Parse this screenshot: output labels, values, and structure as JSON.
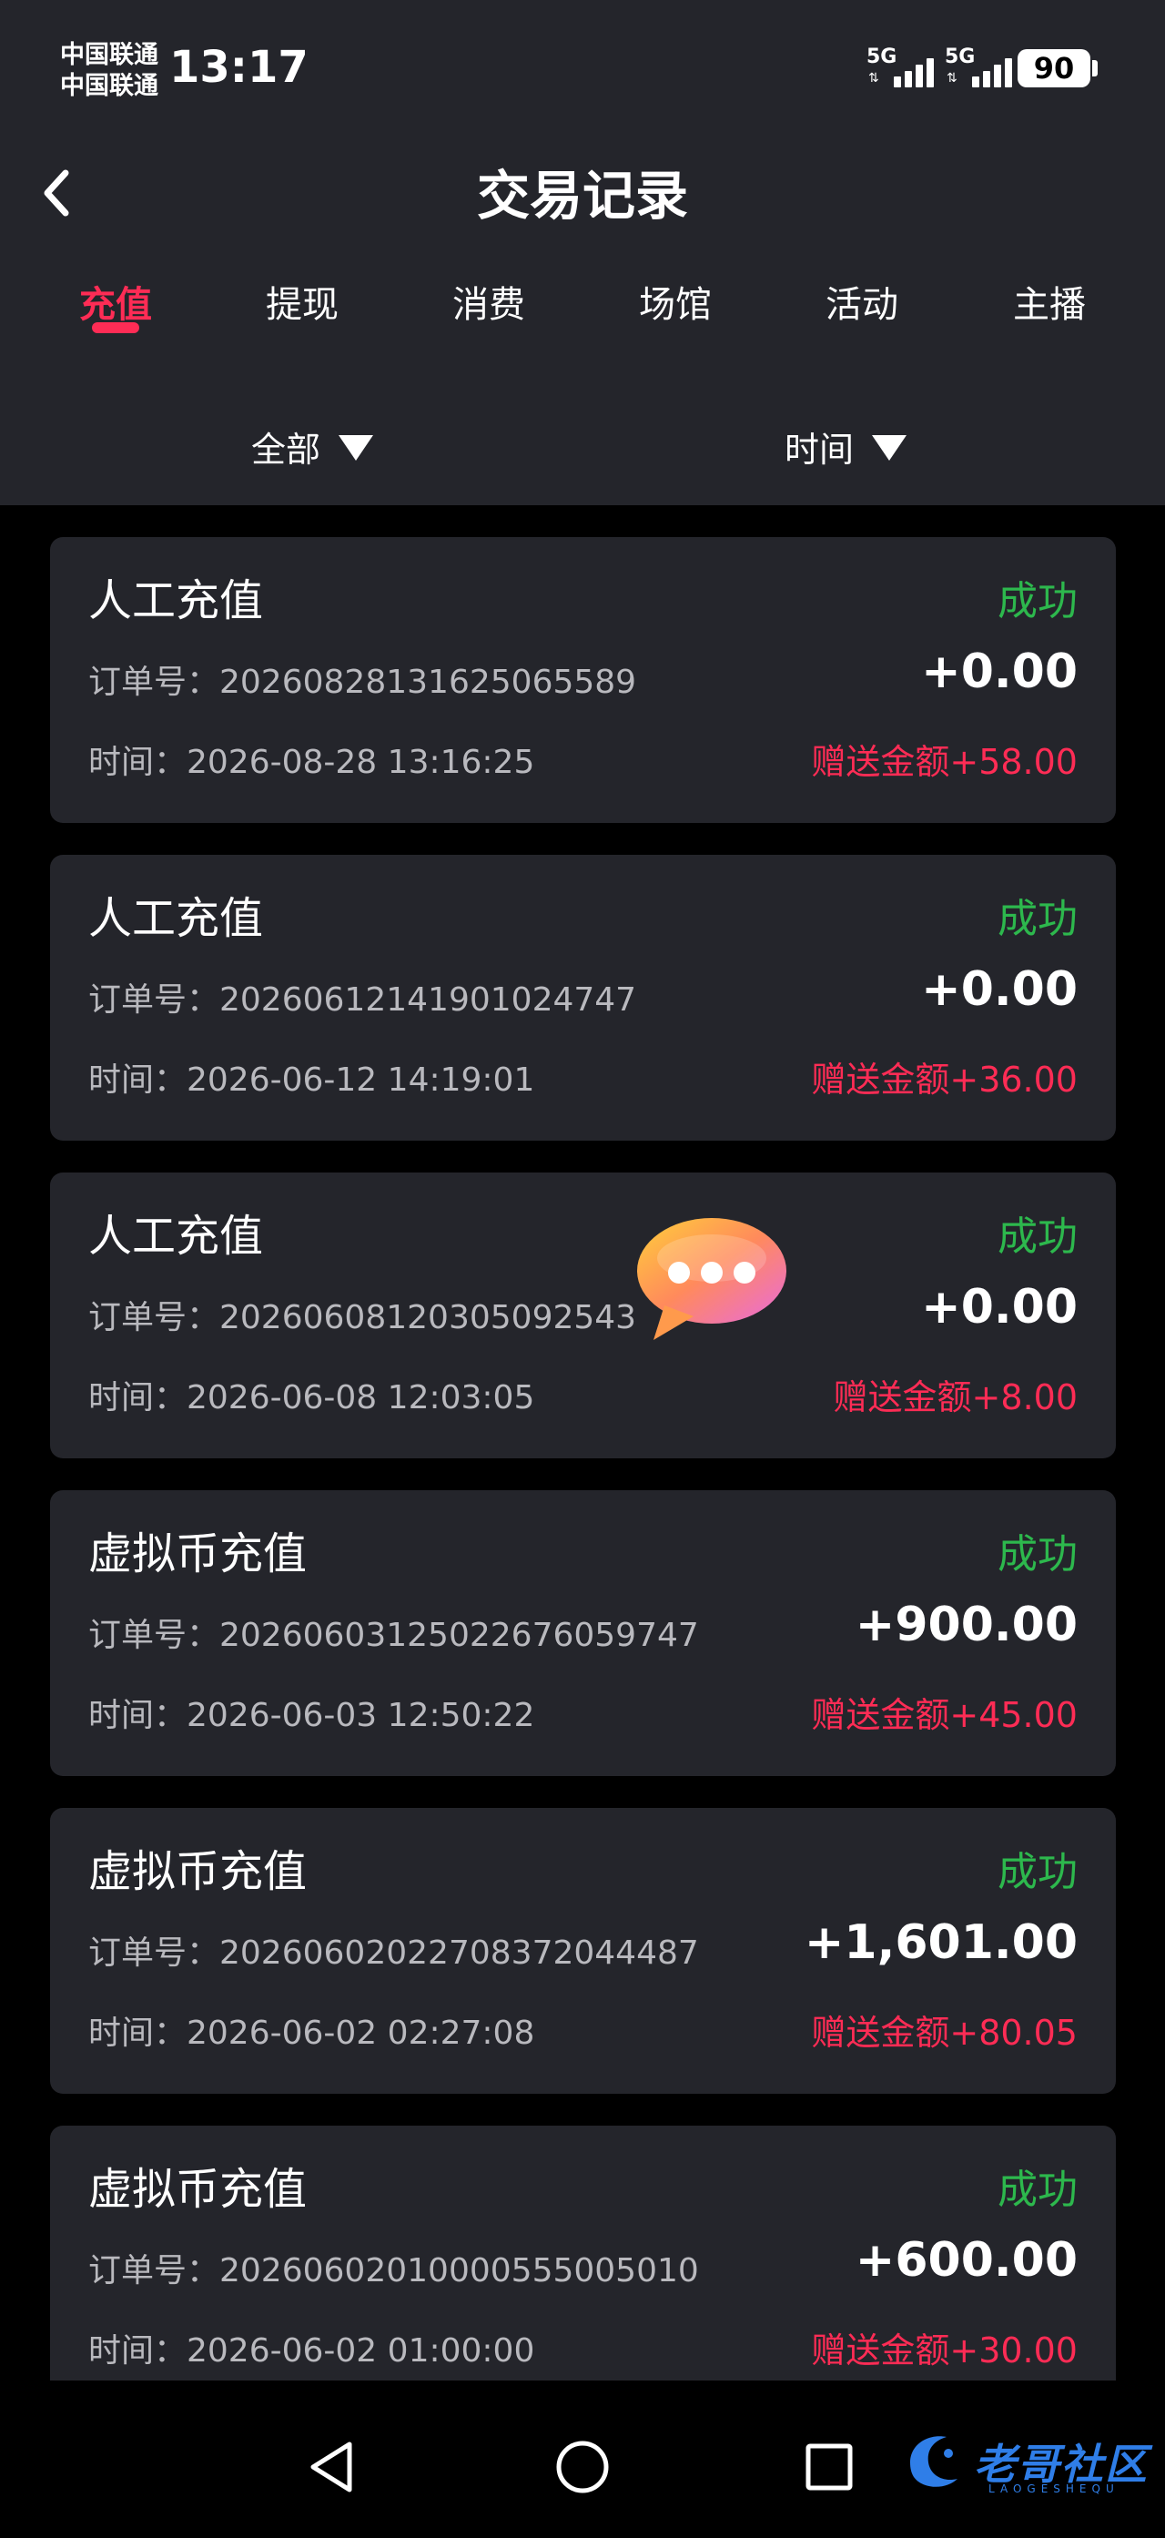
{
  "status_bar": {
    "carrier_1": "中国联通",
    "carrier_2": "中国联通",
    "time": "13:17",
    "network_1": "5G",
    "network_2": "5G",
    "battery": "90"
  },
  "header": {
    "title": "交易记录",
    "back_icon": "chevron-left-icon"
  },
  "tabs": [
    {
      "label": "充值",
      "active": true
    },
    {
      "label": "提现",
      "active": false
    },
    {
      "label": "消费",
      "active": false
    },
    {
      "label": "场馆",
      "active": false
    },
    {
      "label": "活动",
      "active": false
    },
    {
      "label": "主播",
      "active": false
    }
  ],
  "filters": {
    "category": "全部",
    "time": "时间"
  },
  "records": [
    {
      "type": "人工充值",
      "status": "成功",
      "order": "订单号：2026082813162506558​9",
      "amount": "+0.00",
      "time": "时间：2026-08-28 13:16:25",
      "bonus": "赠送金额+58.00"
    },
    {
      "type": "人工充值",
      "status": "成功",
      "order": "订单号：202606121419010247​47",
      "amount": "+0.00",
      "time": "时间：2026-06-12 14:19:01",
      "bonus": "赠送金额+36.00"
    },
    {
      "type": "人工充值",
      "status": "成功",
      "order": "订单号：2026060812030509254​3",
      "amount": "+0.00",
      "time": "时间：2026-06-08 12:03:05",
      "bonus": "赠送金额+8.00"
    },
    {
      "type": "虚拟币充值",
      "status": "成功",
      "order": "订单号：2026060312502267605​9747",
      "amount": "+900.00",
      "time": "时间：2026-06-03 12:50:22",
      "bonus": "赠送金额+45.00"
    },
    {
      "type": "虚拟币充值",
      "status": "成功",
      "order": "订单号：202606020227083720​44487",
      "amount": "+1,601.00",
      "time": "时间：2026-06-02 02:27:08",
      "bonus": "赠送金额+80.05"
    },
    {
      "type": "虚拟币充值",
      "status": "成功",
      "order": "订单号：2026060201000055500​5010",
      "amount": "+600.00",
      "time": "时间：2026-06-02 01:00:00",
      "bonus": "赠送金额+30.00"
    }
  ],
  "watermark": {
    "text": "老哥社区",
    "sub": "LAOGESHEQU"
  },
  "colors": {
    "accent": "#fe2c55",
    "success": "#2db84d",
    "card_bg": "#24252b",
    "page_bg": "#000000"
  }
}
